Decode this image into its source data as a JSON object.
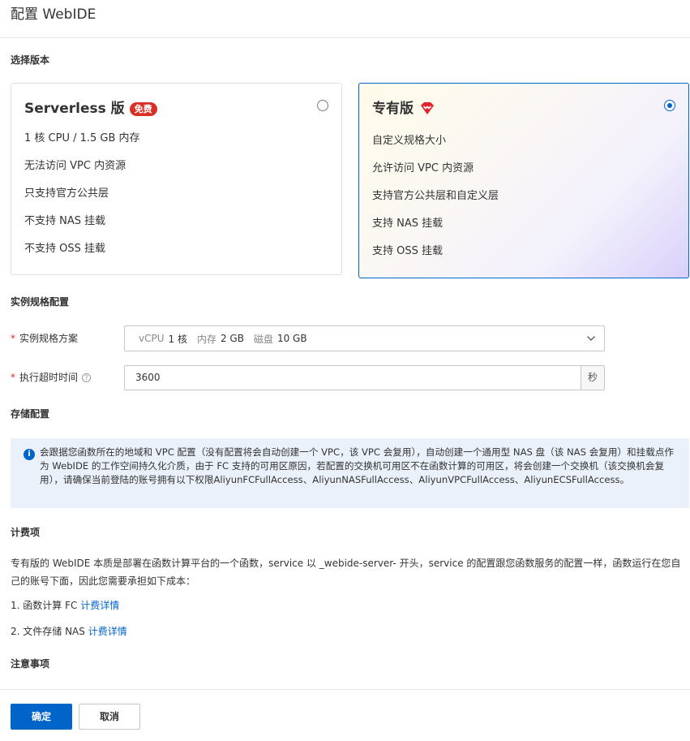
{
  "header": {
    "title": "配置 WebIDE"
  },
  "version_section": {
    "title": "选择版本",
    "serverless": {
      "name": "Serverless 版",
      "badge": "免费",
      "selected": false,
      "features": [
        "1 核 CPU / 1.5 GB 内存",
        "无法访问 VPC 内资源",
        "只支持官方公共层",
        "不支持 NAS 挂载",
        "不支持 OSS 挂载"
      ]
    },
    "dedicated": {
      "name": "专有版",
      "icon": "diamond-icon",
      "selected": true,
      "features": [
        "自定义规格大小",
        "允许访问 VPC 内资源",
        "支持官方公共层和自定义层",
        "支持 NAS 挂载",
        "支持 OSS 挂载"
      ]
    }
  },
  "instance_section": {
    "title": "实例规格配置",
    "spec": {
      "label": "实例规格方案",
      "required_mark": "*",
      "cpu_label": "vCPU",
      "cpu_value": "1 核",
      "mem_label": "内存",
      "mem_value": "2 GB",
      "disk_label": "磁盘",
      "disk_value": "10 GB"
    },
    "timeout": {
      "label": "执行超时时间",
      "required_mark": "*",
      "help_icon": "?",
      "value": "3600",
      "unit": "秒"
    }
  },
  "storage_section": {
    "title": "存储配置",
    "info_icon": "i",
    "info_text": "会跟据您函数所在的地域和 VPC 配置（没有配置将会自动创建一个 VPC，该 VPC 会复用），自动创建一个通用型 NAS 盘（该 NAS 会复用）和挂载点作为 WebIDE 的工作空间持久化介质，由于 FC 支持的可用区原因，若配置的交换机可用区不在函数计算的可用区，将会创建一个交换机（该交换机会复用），请确保当前登陆的账号拥有以下权限AliyunFCFullAccess、AliyunNASFullAccess、AliyunVPCFullAccess、AliyunECSFullAccess。"
  },
  "billing_section": {
    "title": "计费项",
    "description": "专有版的 WebIDE 本质是部署在函数计算平台的一个函数，service 以 _webide-server- 开头，service 的配置跟您函数服务的配置一样，函数运行在您自己的账号下面，因此您需要承担如下成本：",
    "items": [
      {
        "text": "1. 函数计算 FC",
        "link": "计费详情"
      },
      {
        "text": "2. 文件存储 NAS",
        "link": "计费详情"
      }
    ]
  },
  "notes_section": {
    "title": "注意事项"
  },
  "footer": {
    "confirm": "确定",
    "cancel": "取消"
  }
}
